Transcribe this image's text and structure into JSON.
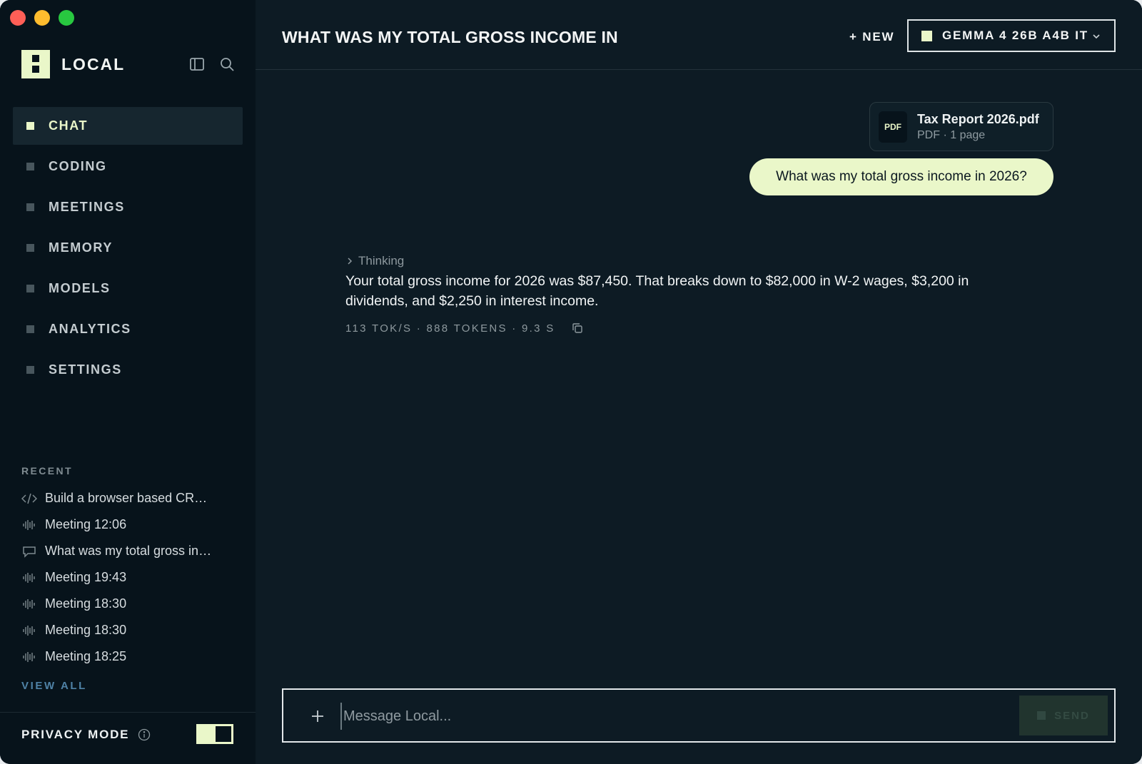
{
  "app": {
    "name": "LOCAL"
  },
  "nav": {
    "items": [
      {
        "label": "CHAT",
        "active": true
      },
      {
        "label": "CODING"
      },
      {
        "label": "MEETINGS"
      },
      {
        "label": "MEMORY"
      },
      {
        "label": "MODELS"
      },
      {
        "label": "ANALYTICS"
      },
      {
        "label": "SETTINGS"
      }
    ]
  },
  "recent": {
    "title": "RECENT",
    "items": [
      {
        "label": "Build a browser based CR…",
        "icon": "code-icon"
      },
      {
        "label": "Meeting 12:06",
        "icon": "waveform-icon"
      },
      {
        "label": "What was my total gross in…",
        "icon": "chat-bubble-icon"
      },
      {
        "label": "Meeting 19:43",
        "icon": "waveform-icon"
      },
      {
        "label": "Meeting 18:30",
        "icon": "waveform-icon"
      },
      {
        "label": "Meeting 18:30",
        "icon": "waveform-icon"
      },
      {
        "label": "Meeting 18:25",
        "icon": "waveform-icon"
      }
    ],
    "view_all": "VIEW ALL"
  },
  "privacy": {
    "label": "PRIVACY MODE",
    "enabled": true
  },
  "header": {
    "title": "WHAT WAS MY TOTAL GROSS INCOME IN",
    "new_label": "+ NEW",
    "model": "GEMMA 4 26B A4B IT"
  },
  "conversation": {
    "attachment": {
      "badge": "PDF",
      "name": "Tax Report 2026.pdf",
      "meta": "PDF · 1 page"
    },
    "user_message": "What was my total gross income in 2026?",
    "thinking_label": "Thinking",
    "assistant_reply": "Your total gross income for 2026 was $87,450. That breaks down to $82,000 in W-2 wages, $3,200 in dividends, and $2,250 in interest income.",
    "stats": "113 TOK/S · 888 TOKENS · 9.3 S"
  },
  "composer": {
    "placeholder": "Message Local...",
    "send_label": "SEND"
  },
  "colors": {
    "accent": "#eaf7c9",
    "sidebar_bg": "#07131b",
    "main_bg": "#0d1b24",
    "link": "#4f82a6"
  }
}
